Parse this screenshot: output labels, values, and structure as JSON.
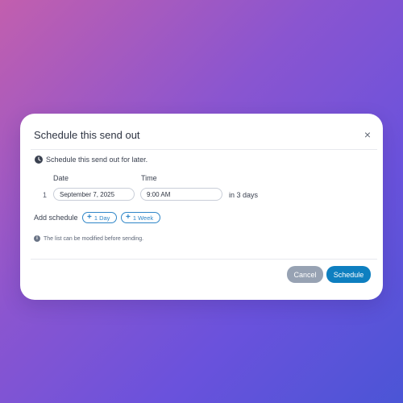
{
  "modal": {
    "title": "Schedule this send out",
    "close_glyph": "×",
    "intro_text": "Schedule this send out for later.",
    "columns": {
      "date": "Date",
      "time": "Time"
    },
    "schedule_row": {
      "index": "1",
      "date_value": "September 7, 2025",
      "time_value": "9:00 AM",
      "relative": "in 3 days"
    },
    "add_schedule": {
      "label": "Add schedule",
      "chips": [
        "1 Day",
        "1 Week"
      ]
    },
    "note": "The list can be modified before sending.",
    "buttons": {
      "cancel": "Cancel",
      "schedule": "Schedule"
    }
  },
  "icons": {
    "intro": "clock-icon",
    "chip": "plus-icon",
    "note": "info-icon",
    "close": "close-icon"
  },
  "colors": {
    "accent": "#2f86c8",
    "primary_button": "#0e7fc0",
    "secondary_button": "#97a2b3"
  }
}
